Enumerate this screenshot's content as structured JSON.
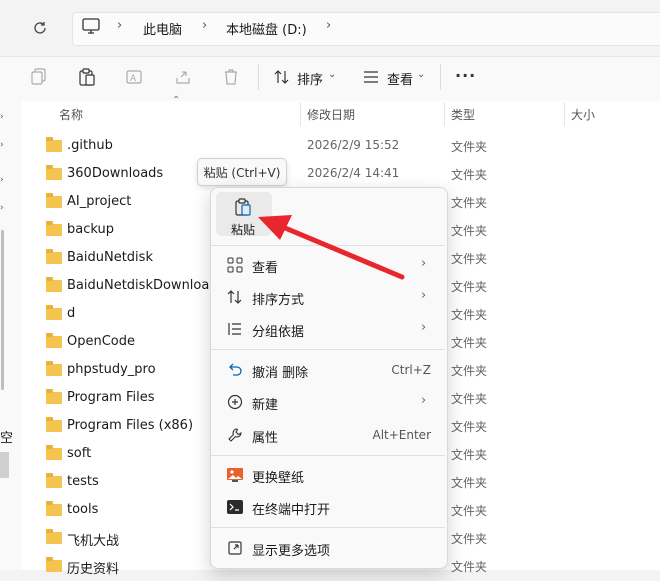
{
  "address": {
    "crumbs": [
      "此电脑",
      "本地磁盘 (D:)"
    ]
  },
  "toolbar": {
    "sort_label": "排序",
    "view_label": "查看",
    "more_label": "···"
  },
  "columns": {
    "name": "名称",
    "date": "修改日期",
    "type": "类型",
    "size": "大小"
  },
  "files": [
    {
      "name": ".github",
      "date": "2026/2/9 15:52",
      "type": "文件夹"
    },
    {
      "name": "360Downloads",
      "date": "2026/2/4 14:41",
      "type": "文件夹"
    },
    {
      "name": "AI_project",
      "date": "",
      "type": "文件夹"
    },
    {
      "name": "backup",
      "date": "",
      "type": "文件夹"
    },
    {
      "name": "BaiduNetdisk",
      "date": "",
      "type": "文件夹"
    },
    {
      "name": "BaiduNetdiskDownload",
      "date": "",
      "type": "文件夹"
    },
    {
      "name": "d",
      "date": "",
      "type": "文件夹"
    },
    {
      "name": "OpenCode",
      "date": "",
      "type": "文件夹"
    },
    {
      "name": "phpstudy_pro",
      "date": "",
      "type": "文件夹"
    },
    {
      "name": "Program Files",
      "date": "",
      "type": "文件夹"
    },
    {
      "name": "Program Files (x86)",
      "date": "",
      "type": "文件夹"
    },
    {
      "name": "soft",
      "date": "",
      "type": "文件夹"
    },
    {
      "name": "tests",
      "date": "",
      "type": "文件夹"
    },
    {
      "name": "tools",
      "date": "",
      "type": "文件夹"
    },
    {
      "name": "飞机大战",
      "date": "",
      "type": "文件夹"
    },
    {
      "name": "历史资料",
      "date": "",
      "type": "文件夹"
    }
  ],
  "nav": {
    "partial_label": "空"
  },
  "tooltip": "粘贴 (Ctrl+V)",
  "menu": {
    "paste_label": "粘贴",
    "items": [
      {
        "label": "查看",
        "icon": "grid-icon",
        "arrow": "›",
        "shortcut": ""
      },
      {
        "label": "排序方式",
        "icon": "sort-icon",
        "arrow": "›",
        "shortcut": ""
      },
      {
        "label": "分组依据",
        "icon": "group-icon",
        "arrow": "›",
        "shortcut": ""
      },
      {
        "label": "撤消 删除",
        "icon": "undo-icon",
        "arrow": "",
        "shortcut": "Ctrl+Z"
      },
      {
        "label": "新建",
        "icon": "new-icon",
        "arrow": "›",
        "shortcut": ""
      },
      {
        "label": "属性",
        "icon": "wrench-icon",
        "arrow": "",
        "shortcut": "Alt+Enter"
      },
      {
        "label": "更换壁纸",
        "icon": "wallpaper-icon",
        "arrow": "",
        "shortcut": ""
      },
      {
        "label": "在终端中打开",
        "icon": "terminal-icon",
        "arrow": "",
        "shortcut": ""
      },
      {
        "label": "显示更多选项",
        "icon": "more-options-icon",
        "arrow": "",
        "shortcut": ""
      }
    ]
  },
  "colors": {
    "accent": "#0067c0",
    "folder": "#f5c44e",
    "annotation_arrow": "#e8262d"
  }
}
